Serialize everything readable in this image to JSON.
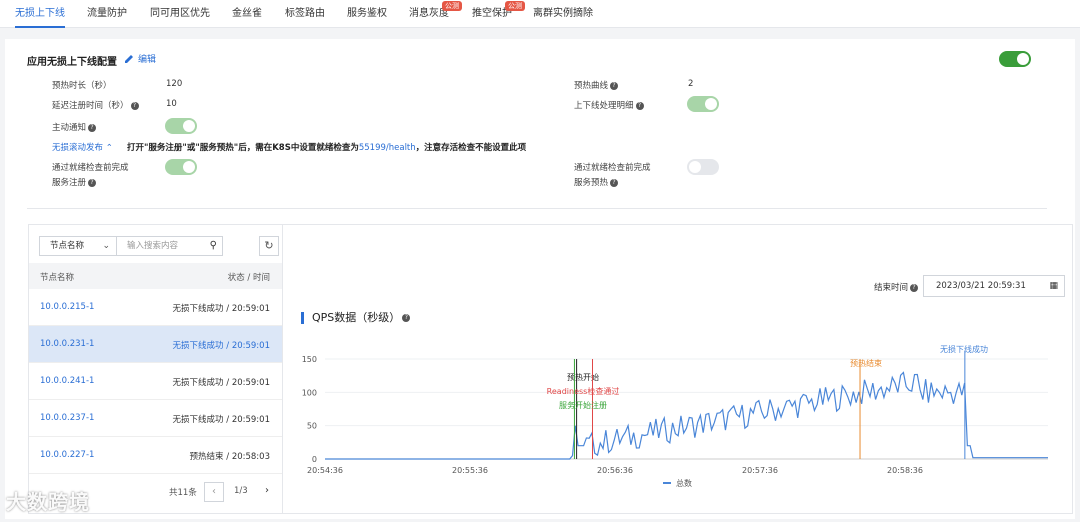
{
  "tabs": [
    {
      "label": "无损上下线",
      "active": true
    },
    {
      "label": "流量防护"
    },
    {
      "label": "同可用区优先"
    },
    {
      "label": "金丝雀"
    },
    {
      "label": "标签路由"
    },
    {
      "label": "服务鉴权"
    },
    {
      "label": "消息灰度",
      "badge": "公测"
    },
    {
      "label": "推空保护",
      "badge": "公测"
    },
    {
      "label": "离群实例摘除"
    }
  ],
  "config": {
    "title": "应用无损上下线配置",
    "edit_label": "编辑",
    "warmup_time_label": "预热时长（秒）",
    "warmup_time_value": "120",
    "delay_register_label": "延迟注册时间（秒）",
    "delay_register_value": "10",
    "active_notify_label": "主动通知",
    "rolling_release_label": "无损滚动发布",
    "rolling_release_note": "打开\"服务注册\"或\"服务预热\"后，需在K8S中设置就绪检查为",
    "rolling_release_link": "55199/health",
    "rolling_release_note_end": "，注意存活检查不能设置此项",
    "readiness_register_label_1": "通过就绪检查前完成",
    "readiness_register_label_2": "服务注册",
    "warmup_curve_label": "预热曲线",
    "warmup_curve_value": "2",
    "online_offline_detail_label": "上下线处理明细",
    "readiness_warmup_label_1": "通过就绪检查前完成",
    "readiness_warmup_label_2": "服务预热"
  },
  "node_list": {
    "filter_select": "节点名称",
    "search_placeholder": "输入搜索内容",
    "col_name": "节点名称",
    "col_status": "状态 / 时间",
    "rows": [
      {
        "ip": "10.0.0.215-1",
        "status": "无损下线成功 / 20:59:01"
      },
      {
        "ip": "10.0.0.231-1",
        "status": "无损下线成功 / 20:59:01",
        "selected": true
      },
      {
        "ip": "10.0.0.241-1",
        "status": "无损下线成功 / 20:59:01"
      },
      {
        "ip": "10.0.0.237-1",
        "status": "无损下线成功 / 20:59:01"
      },
      {
        "ip": "10.0.0.227-1",
        "status": "预热结束 / 20:58:03"
      }
    ],
    "total": "共11条",
    "page": "1/3"
  },
  "chart_panel": {
    "end_time_label": "结束时间",
    "end_time_value": "2023/03/21 20:59:31",
    "title": "QPS数据（秒级）"
  },
  "chart_data": {
    "type": "line",
    "title": "QPS数据（秒级）",
    "x_ticks": [
      "20:54:36",
      "20:55:36",
      "20:56:36",
      "20:57:36",
      "20:58:36"
    ],
    "y_ticks": [
      0,
      50,
      100,
      150
    ],
    "ylim": [
      0,
      150
    ],
    "series": [
      {
        "name": "总数",
        "color": "#4a86d8"
      }
    ],
    "markers": [
      {
        "label": "预热开始",
        "color": "#222222"
      },
      {
        "label": "Readiness检查通过",
        "color": "#e04848"
      },
      {
        "label": "服务开始注册",
        "color": "#3aa53a"
      },
      {
        "label": "预热结束",
        "color": "#e88a2e"
      },
      {
        "label": "无损下线成功",
        "color": "#4a86d8"
      }
    ]
  },
  "watermark": "大数跨境"
}
